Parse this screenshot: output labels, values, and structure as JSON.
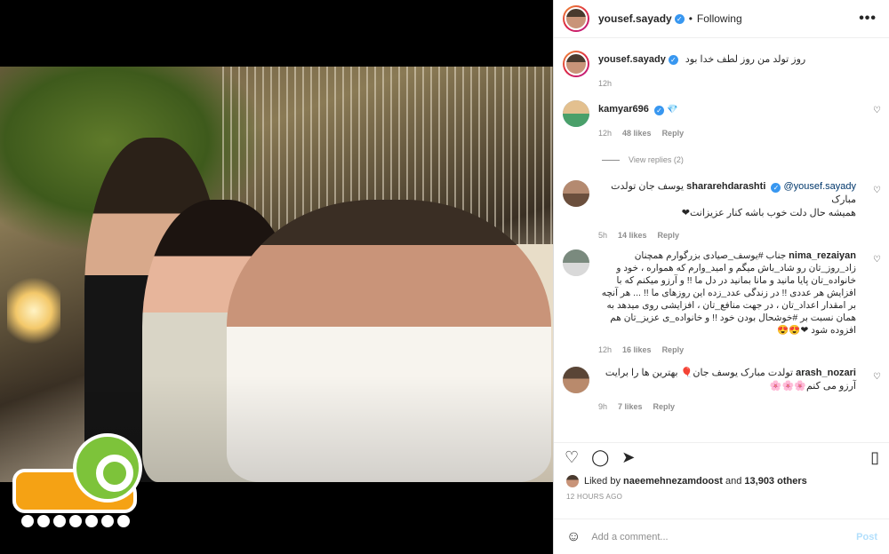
{
  "post": {
    "username": "yousef.sayady",
    "separator": "•",
    "following_label": "Following",
    "more_label": "•••"
  },
  "caption": {
    "username": "yousef.sayady",
    "text": "روز تولد من روز لطف خدا بود",
    "time": "12h"
  },
  "comments": [
    {
      "username": "kamyar696",
      "badge": "💎",
      "text": "",
      "time": "12h",
      "likes": "48 likes",
      "reply": "Reply"
    },
    {
      "username": "shararehdarashti",
      "mention": "@yousef.sayady",
      "text_line1": "یوسف جان تولدت مبارک",
      "text_line2": "همیشه حال دلت خوب باشه کنار عزیزانت❤",
      "time": "5h",
      "likes": "14 likes",
      "reply": "Reply"
    },
    {
      "username": "nima_rezaiyan",
      "text": "جناب #یوسف_صیادی بزرگوارم همچنان زاد_روز_تان رو شاد_باش میگم و امید_وارم که همواره ، خود و خانواده_تان پایا مانید و مانا بمانید در دل ما !! و آرزو میکنم که با افزایش هر عددی !! در زندگی عدد_زده این روزهای ما !! ... هر آنچه بر امقدار اعداد_تان ، در جهت منافع_تان ، افزایشی روی میدهد به همان نسبت بر #خوشحال بودن خود !! و خانواده_ی عزیز_تان هم افزوده شود ❤😍😍",
      "time": "12h",
      "likes": "16 likes",
      "reply": "Reply"
    },
    {
      "username": "arash_nozari",
      "text": "تولدت مبارک یوسف جان🎈 بهترین ها را برایت آرزو می کنم🌸🌸🌸",
      "time": "9h",
      "likes": "7 likes",
      "reply": "Reply"
    }
  ],
  "view_replies": "View replies (2)",
  "actions": {
    "like_icon": "♡",
    "comment_icon": "◯",
    "share_icon": "➤",
    "save_icon": "▯"
  },
  "liked_by": {
    "prefix": "Liked by",
    "user": "naeemehnezamdoost",
    "middle": "and",
    "others": "13,903 others"
  },
  "posted_ago": "12 HOURS AGO",
  "add_comment": {
    "emoji_icon": "☺",
    "placeholder": "Add a comment...",
    "post_label": "Post"
  }
}
